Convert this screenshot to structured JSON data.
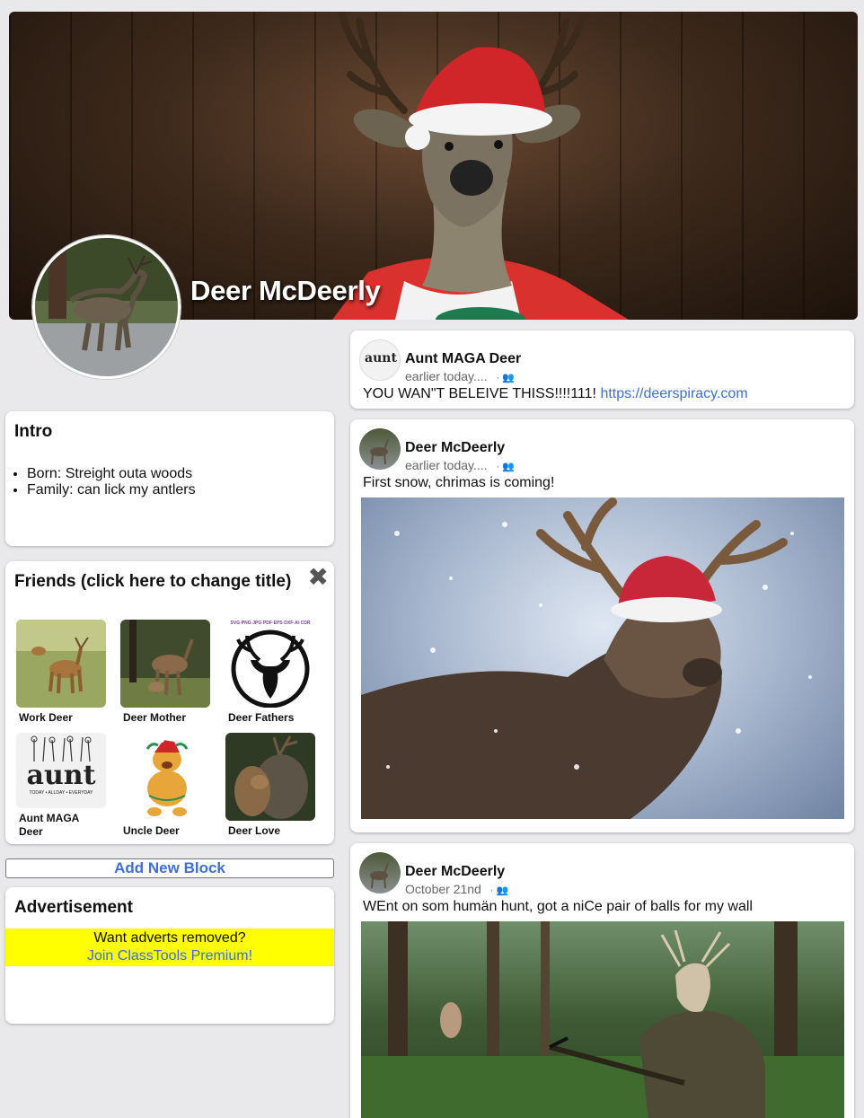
{
  "profile": {
    "name": "Deer McDeerly"
  },
  "intro": {
    "title": "Intro",
    "items": [
      "Born: Streight outa woods",
      "Family: can lick my antlers"
    ]
  },
  "friends": {
    "title": "Friends (click here to change title)",
    "close_label": "✖",
    "list": [
      {
        "name": "Work Deer"
      },
      {
        "name": "Deer Mother"
      },
      {
        "name": "Deer Fathers"
      },
      {
        "name": "Aunt MAGA Deer"
      },
      {
        "name": "Uncle Deer"
      },
      {
        "name": "Deer Love"
      }
    ],
    "aunt_logo_text": "aunt",
    "aunt_logo_sub": "TODAY • ALLDAY • EVERYDAY",
    "fathers_banner": "SVG·PNG·JPG·PDF·EPS·DXF·AI·CDR"
  },
  "add_block": {
    "label": "Add New Block"
  },
  "advert": {
    "title": "Advertisement",
    "line1": "Want adverts removed?",
    "link": "Join ClassTools Premium!"
  },
  "posts": [
    {
      "author": "Aunt MAGA Deer",
      "time": "earlier today....",
      "privacy": "· 👥",
      "text": "YOU WAN\"T BELEIVE THISS!!!!111! ",
      "link": "https://deerspiracy.com",
      "avatar_text": "aunt"
    },
    {
      "author": "Deer McDeerly",
      "time": "earlier today....",
      "privacy": "· 👥",
      "text": "First snow, chrimas is coming!"
    },
    {
      "author": "Deer McDeerly",
      "time": "October 21nd",
      "privacy": "· 👥",
      "text": "WEnt on som humän hunt, got a niCe pair of balls for my wall"
    }
  ],
  "colors": {
    "link": "#3e6fd6",
    "advert_bg": "#ffff00",
    "page_bg": "#e9e9eb"
  }
}
